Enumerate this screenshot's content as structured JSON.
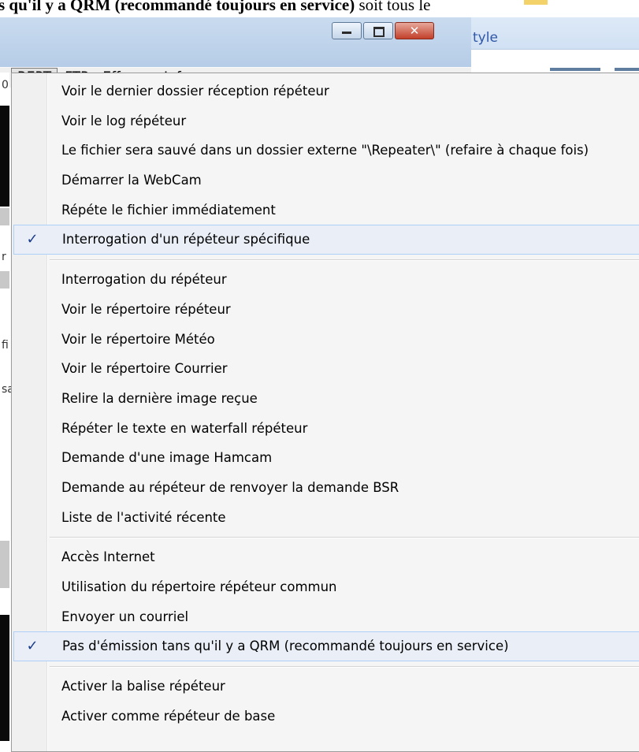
{
  "document_fragment": {
    "bold_text": "s qu'il y a QRM (recommandé toujours en service)",
    "normal_text": " soit tous le"
  },
  "window": {
    "buttons": {
      "minimize_icon": "minimize-icon",
      "maximize_icon": "maximize-icon",
      "close_icon": "close-icon",
      "close_glyph": "✕"
    }
  },
  "ribbon": {
    "label": "tyle"
  },
  "menubar": {
    "items": [
      {
        "label": "REPT",
        "active": true
      },
      {
        "label": "FTP",
        "active": false
      },
      {
        "label": "Effacer",
        "active": false
      },
      {
        "label": "Infos",
        "active": false
      }
    ]
  },
  "left_edge_fragments": [
    "0",
    "r",
    "fi",
    "sa"
  ],
  "menu": {
    "check_glyph": "✓",
    "groups": [
      [
        {
          "label": "Voir le dernier dossier réception répéteur",
          "checked": false
        },
        {
          "label": "Voir le log répéteur",
          "checked": false
        },
        {
          "label": "Le fichier sera sauvé dans un dossier externe \"\\Repeater\\\" (refaire à chaque fois)",
          "checked": false
        },
        {
          "label": "Démarrer la WebCam",
          "checked": false
        },
        {
          "label": "Répéte le fichier immédiatement",
          "checked": false
        },
        {
          "label": "Interrogation d'un répéteur spécifique",
          "checked": true
        }
      ],
      [
        {
          "label": "Interrogation du répéteur",
          "checked": false
        },
        {
          "label": "Voir le répertoire répéteur",
          "checked": false
        },
        {
          "label": "Voir le répertoire Météo",
          "checked": false
        },
        {
          "label": "Voir le répertoire Courrier",
          "checked": false
        },
        {
          "label": "Relire la dernière image reçue",
          "checked": false
        },
        {
          "label": "Répéter le texte en waterfall répéteur",
          "checked": false
        },
        {
          "label": "Demande d'une image Hamcam",
          "checked": false
        },
        {
          "label": "Demande au répéteur de renvoyer la demande BSR",
          "checked": false
        },
        {
          "label": "Liste de l'activité récente",
          "checked": false
        }
      ],
      [
        {
          "label": "Accès Internet",
          "checked": false
        },
        {
          "label": "Utilisation du répertoire répéteur commun",
          "checked": false
        },
        {
          "label": "Envoyer un courriel",
          "checked": false
        },
        {
          "label": "Pas d'émission tans qu'il y a QRM (recommandé toujours en service)",
          "checked": true
        }
      ],
      [
        {
          "label": "Activer la balise répéteur",
          "checked": false
        },
        {
          "label": "Activer comme répéteur de base",
          "checked": false
        }
      ]
    ]
  }
}
